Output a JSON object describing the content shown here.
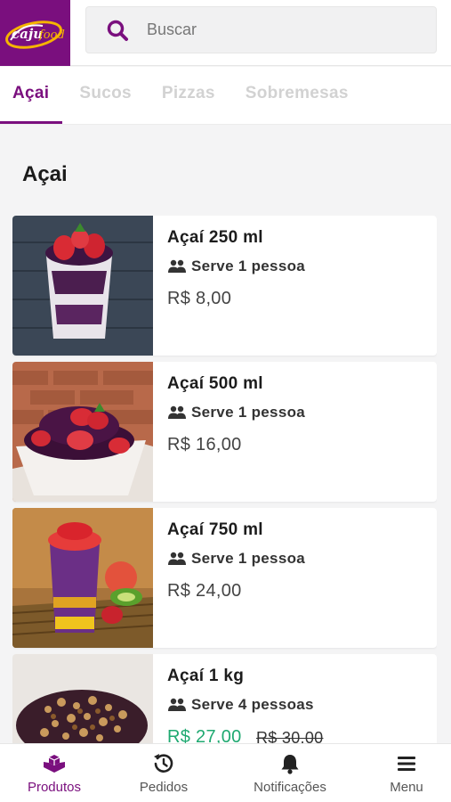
{
  "header": {
    "logo_text": "Cajufood",
    "search": {
      "placeholder": "Buscar",
      "value": ""
    }
  },
  "tabs": [
    {
      "label": "Açai",
      "active": true
    },
    {
      "label": "Sucos",
      "active": false
    },
    {
      "label": "Pizzas",
      "active": false
    },
    {
      "label": "Sobremesas",
      "active": false
    }
  ],
  "section": {
    "title": "Açai"
  },
  "products": [
    {
      "name": "Açaí 250 ml",
      "serves": "Serve 1 pessoa",
      "price": "R$ 8,00",
      "old_price": "",
      "image": "acai-cup-strawberry-image"
    },
    {
      "name": "Açaí 500 ml",
      "serves": "Serve 1 pessoa",
      "price": "R$ 16,00",
      "old_price": "",
      "image": "acai-bowl-strawberry-image"
    },
    {
      "name": "Açaí 750 ml",
      "serves": "Serve 1 pessoa",
      "price": "R$ 24,00",
      "old_price": "",
      "image": "acai-cup-fruits-image"
    },
    {
      "name": "Açaí 1 kg",
      "serves": "Serve 4 pessoas",
      "price": "R$ 27,00",
      "old_price": "R$ 30,00",
      "image": "acai-granola-image"
    }
  ],
  "bottom_nav": [
    {
      "label": "Produtos",
      "icon": "products-icon",
      "active": true
    },
    {
      "label": "Pedidos",
      "icon": "history-icon",
      "active": false
    },
    {
      "label": "Notificações",
      "icon": "bell-icon",
      "active": false
    },
    {
      "label": "Menu",
      "icon": "hamburger-menu-icon",
      "active": false
    }
  ],
  "colors": {
    "brand": "#7a0f7e",
    "promo_price": "#1fa971",
    "inactive_tab": "#d2d2d2",
    "background": "#f4f4f5"
  }
}
